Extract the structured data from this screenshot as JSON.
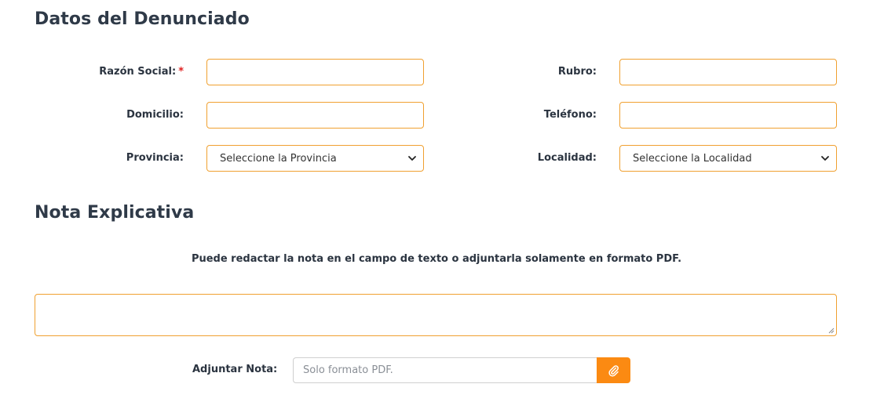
{
  "sections": {
    "denunciado_title": "Datos del Denunciado",
    "nota_title": "Nota Explicativa"
  },
  "fields": {
    "razon_social": {
      "label": "Razón Social:",
      "required_mark": "*",
      "value": ""
    },
    "rubro": {
      "label": "Rubro:",
      "value": ""
    },
    "domicilio": {
      "label": "Domicilio:",
      "value": ""
    },
    "telefono": {
      "label": "Teléfono:",
      "value": ""
    },
    "provincia": {
      "label": "Provincia:",
      "selected": "Seleccione la Provincia"
    },
    "localidad": {
      "label": "Localidad:",
      "selected": "Seleccione la Localidad"
    }
  },
  "nota": {
    "help_text": "Puede redactar la nota en el campo de texto o adjuntarla solamente en formato PDF.",
    "textarea_value": "",
    "attach_label": "Adjuntar Nota:",
    "file_placeholder": "Solo formato PDF.",
    "attach_icon": "paperclip-icon"
  },
  "colors": {
    "accent": "#fb8a12",
    "input_border": "#f0a030",
    "required": "#e02020",
    "heading": "#2f3a48"
  }
}
